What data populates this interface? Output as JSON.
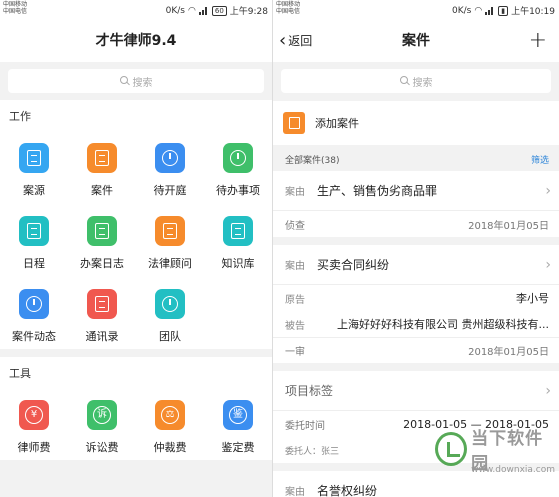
{
  "status_left": {
    "carrier1": "中国移动",
    "carrier2": "中国电信",
    "speed": "0K/s",
    "battery": "60",
    "time": "上午9:28"
  },
  "status_right": {
    "carrier1": "中国移动",
    "carrier2": "中国电信",
    "speed": "0K/s",
    "time": "上午10:19"
  },
  "left": {
    "title": "才牛律师9.4",
    "search_placeholder": "搜索",
    "work_section": "工作",
    "tools_section": "工具",
    "work_items": [
      {
        "label": "案源",
        "icon": "document-list-icon",
        "color": "#35a6f1"
      },
      {
        "label": "案件",
        "icon": "case-file-icon",
        "color": "#f68b2c"
      },
      {
        "label": "待开庭",
        "icon": "clock-icon",
        "color": "#3b8ef0"
      },
      {
        "label": "待办事项",
        "icon": "check-circle-icon",
        "color": "#3fbf6a"
      },
      {
        "label": "日程",
        "icon": "calendar-icon",
        "color": "#22bfc3"
      },
      {
        "label": "办案日志",
        "icon": "notebook-icon",
        "color": "#3fbf6a"
      },
      {
        "label": "法律顾问",
        "icon": "tie-icon",
        "color": "#f68b2c"
      },
      {
        "label": "知识库",
        "icon": "graduation-cap-icon",
        "color": "#22bfc3"
      },
      {
        "label": "案件动态",
        "icon": "refresh-star-icon",
        "color": "#3b8ef0"
      },
      {
        "label": "通讯录",
        "icon": "contacts-icon",
        "color": "#f0584f"
      },
      {
        "label": "团队",
        "icon": "team-icon",
        "color": "#22bfc3"
      }
    ],
    "tool_items": [
      {
        "label": "律师费",
        "icon": "yen-bag-icon",
        "glyph": "¥",
        "color": "#f0584f"
      },
      {
        "label": "诉讼费",
        "icon": "litigation-icon",
        "glyph": "诉",
        "color": "#3fbf6a"
      },
      {
        "label": "仲裁费",
        "icon": "scale-icon",
        "glyph": "⚖",
        "color": "#f68b2c"
      },
      {
        "label": "鉴定费",
        "icon": "appraisal-icon",
        "glyph": "鉴",
        "color": "#3b8ef0"
      }
    ]
  },
  "right": {
    "back_label": "返回",
    "title": "案件",
    "plus": "+",
    "search_placeholder": "搜索",
    "add_case": "添加案件",
    "all_cases": "全部案件(38)",
    "filter": "筛选",
    "cases": [
      {
        "label": "案由",
        "title": "生产、销售伪劣商品罪",
        "stage": "侦查",
        "date": "2018年01月05日"
      },
      {
        "label": "案由",
        "title": "买卖合同纠纷",
        "plaintiff_label": "原告",
        "plaintiff": "李小号",
        "defendant_label": "被告",
        "defendant": "上海好好好科技有限公司 贵州超级科技有...",
        "stage": "一审",
        "date": "2018年01月05日"
      }
    ],
    "tag_card": {
      "title": "项目标签",
      "entrust_label": "委托时间",
      "entrust_range": "2018-01-05 — 2018-01-05",
      "client": "委托人：张三"
    },
    "last_case": {
      "label": "案由",
      "title": "名誉权纠纷"
    }
  },
  "watermark": {
    "text": "当下软件园",
    "url": "www.downxia.com"
  }
}
